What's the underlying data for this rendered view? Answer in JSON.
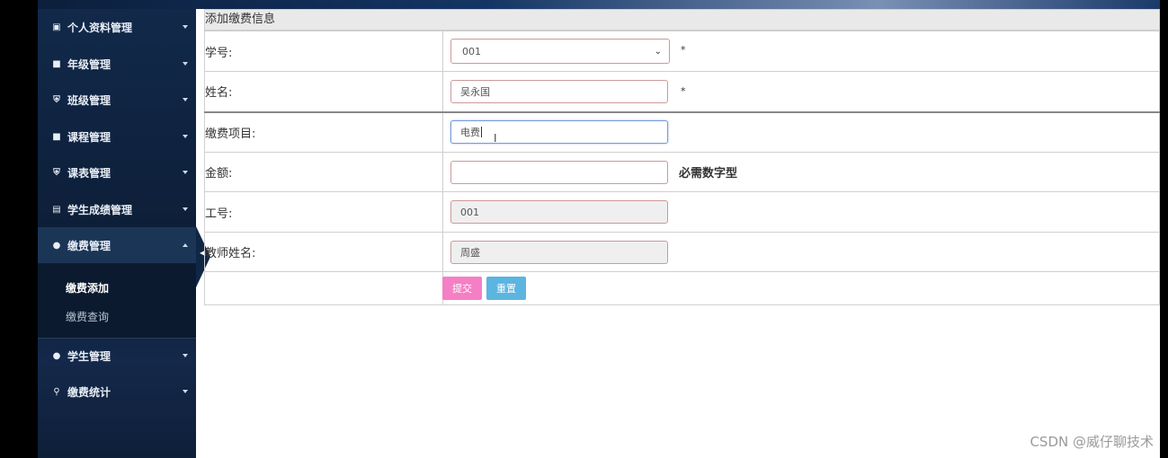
{
  "sidebar": {
    "items": [
      {
        "label": "个人资料管理",
        "icon": "id-card-icon"
      },
      {
        "label": "年级管理",
        "icon": "book-icon"
      },
      {
        "label": "班级管理",
        "icon": "shield-icon"
      },
      {
        "label": "课程管理",
        "icon": "book-icon"
      },
      {
        "label": "课表管理",
        "icon": "shield-icon"
      },
      {
        "label": "学生成绩管理",
        "icon": "file-icon"
      },
      {
        "label": "缴费管理",
        "icon": "users-icon"
      },
      {
        "label": "学生管理",
        "icon": "users-icon"
      },
      {
        "label": "缴费统计",
        "icon": "search-icon"
      }
    ],
    "submenu": [
      {
        "label": "缴费添加"
      },
      {
        "label": "缴费查询"
      }
    ]
  },
  "form": {
    "title": "添加缴费信息",
    "fields": {
      "student_no": {
        "label": "学号:",
        "value": "001",
        "required_mark": "*"
      },
      "name": {
        "label": "姓名:",
        "value": "吴永国",
        "required_mark": "*"
      },
      "fee_item": {
        "label": "缴费项目:",
        "value": "电费"
      },
      "amount": {
        "label": "金额:",
        "value": "",
        "hint": "必需数字型"
      },
      "staff_no": {
        "label": "工号:",
        "value": "001"
      },
      "teacher_name": {
        "label": "教师姓名:",
        "value": "周盛"
      }
    },
    "submit_label": "提交",
    "reset_label": "重置"
  },
  "watermark": "CSDN @威仔聊技术",
  "colors": {
    "sidebar_bg": "#0f2340",
    "submit_btn": "#f57fc4",
    "reset_btn": "#5bb5e0"
  }
}
